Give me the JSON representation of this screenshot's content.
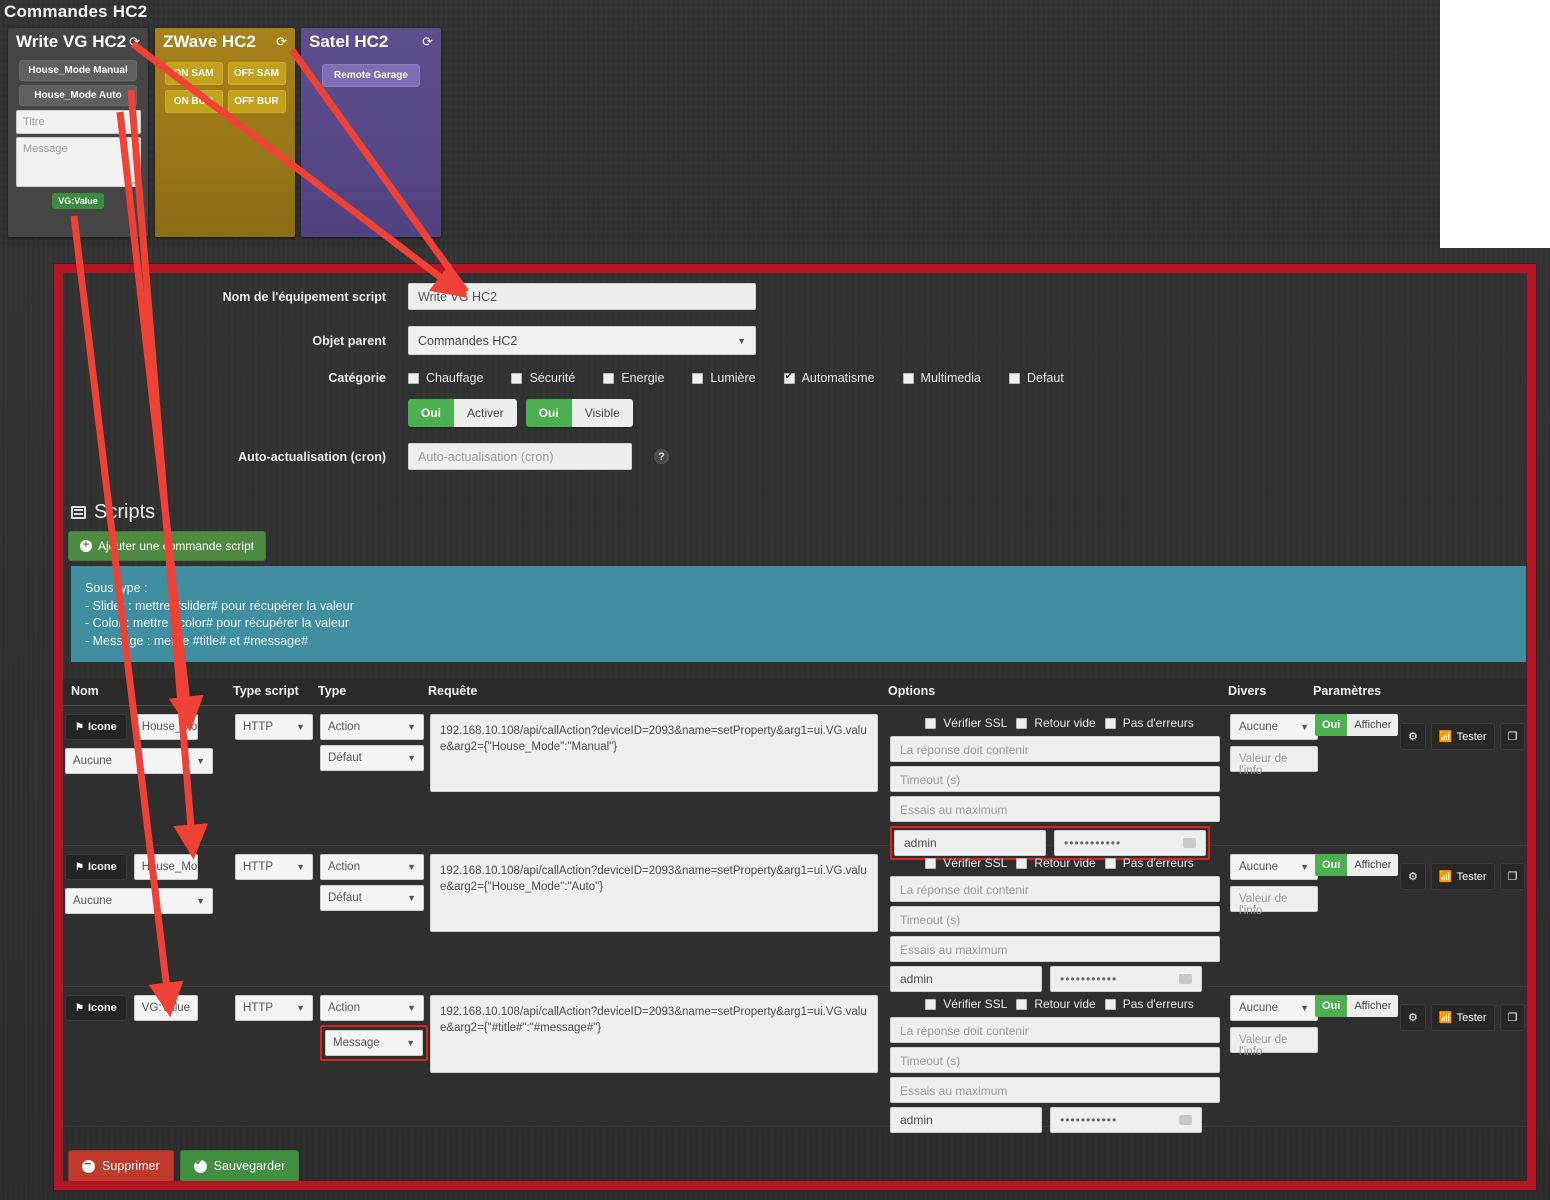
{
  "dashboard": {
    "title": "Commandes HC2",
    "refresh_icon": "refresh-icon",
    "widgets": [
      {
        "title": "Write VG HC2",
        "color": "#454545",
        "buttons": [
          "House_Mode Manual",
          "House_Mode Auto"
        ],
        "inputs": [
          {
            "placeholder": "Titre"
          },
          {
            "placeholder": "Message"
          }
        ],
        "badge": "VG:Value",
        "badge_color": "#3c8c40"
      },
      {
        "title": "ZWave HC2",
        "color": "#9a7718",
        "buttons": [
          "ON SAM",
          "OFF SAM",
          "ON BUR",
          "OFF BUR"
        ]
      },
      {
        "title": "Satel HC2",
        "color": "#564787",
        "buttons": [
          "Remote Garage"
        ]
      }
    ]
  },
  "form": {
    "name": {
      "label": "Nom de l'équipement script",
      "value": "Write VG HC2",
      "placeholder": "Nom de l'équipement script"
    },
    "parent": {
      "label": "Objet parent",
      "value": "Commandes HC2"
    },
    "category": {
      "label": "Catégorie",
      "items": [
        {
          "label": "Chauffage",
          "checked": false
        },
        {
          "label": "Sécurité",
          "checked": false
        },
        {
          "label": "Energie",
          "checked": false
        },
        {
          "label": "Lumière",
          "checked": false
        },
        {
          "label": "Automatisme",
          "checked": true
        },
        {
          "label": "Multimedia",
          "checked": false
        },
        {
          "label": "Defaut",
          "checked": false
        }
      ]
    },
    "toggles": [
      {
        "on_label": "Oui",
        "off_label": "Activer"
      },
      {
        "on_label": "Oui",
        "off_label": "Visible"
      }
    ],
    "cron": {
      "label": "Auto-actualisation (cron)",
      "placeholder": "Auto-actualisation (cron)",
      "value": "",
      "help_icon": "help-icon"
    }
  },
  "scripts": {
    "heading": "Scripts",
    "heading_icon": "list-icon",
    "add_button": "Ajouter une commande script",
    "info": [
      "Sous type :",
      "- Slider : mettre #slider# pour récupérer la valeur",
      "- Color : mettre #color# pour récupérer la valeur",
      "- Message : mettre #title# et #message#"
    ],
    "info_bg": "#3f8fa0",
    "columns": [
      "Nom",
      "Type script",
      "Type",
      "Requête",
      "Options",
      "Divers",
      "Paramètres"
    ],
    "option_checks": [
      "Vérifier SSL",
      "Retour vide",
      "Pas d'erreurs"
    ],
    "option_placeholders": [
      "La réponse doit contenir",
      "Timeout (s)",
      "Essais au maximum"
    ],
    "divers_placeholder": "Valeur de l'info",
    "icone_label": "Icone",
    "icone_icon": "flag-icon",
    "action_icons": {
      "config": "gears-icon",
      "test_label": "Tester",
      "test_icon": "rss-icon",
      "duplicate": "copy-icon",
      "remove": "minus-circle-icon"
    },
    "rows": [
      {
        "name_value": "House_Mo",
        "icon_select": "Aucune",
        "type_script": "HTTP",
        "type": "Action",
        "subtype": "Défaut",
        "subtype_highlighted": false,
        "request": "192.168.10.108/api/callAction?deviceID=2093&name=setProperty&arg1=ui.VG.value&arg2={\"House_Mode\":\"Manual\"}",
        "user": "admin",
        "password": "•••••••••••",
        "credentials_highlighted": true,
        "divers": "Aucune",
        "param_on": "Oui",
        "param_off": "Afficher"
      },
      {
        "name_value": "House_Mo",
        "icon_select": "Aucune",
        "type_script": "HTTP",
        "type": "Action",
        "subtype": "Défaut",
        "subtype_highlighted": false,
        "request": "192.168.10.108/api/callAction?deviceID=2093&name=setProperty&arg1=ui.VG.value&arg2={\"House_Mode\":\"Auto\"}",
        "user": "admin",
        "password": "•••••••••••",
        "credentials_highlighted": false,
        "divers": "Aucune",
        "param_on": "Oui",
        "param_off": "Afficher"
      },
      {
        "name_value": "VG:Value",
        "icon_select": "",
        "type_script": "HTTP",
        "type": "Action",
        "subtype": "Message",
        "subtype_highlighted": true,
        "request": "192.168.10.108/api/callAction?deviceID=2093&name=setProperty&arg1=ui.VG.value&arg2={\"#title#\":\"#message#\"}",
        "user": "admin",
        "password": "•••••••••••",
        "credentials_highlighted": false,
        "divers": "Aucune",
        "param_on": "Oui",
        "param_off": "Afficher"
      }
    ]
  },
  "footer": {
    "delete_label": "Supprimer",
    "save_label": "Sauvegarder",
    "delete_color": "#c0392b",
    "save_color": "#3f8f3f"
  },
  "annotation": {
    "color": "#ef4136",
    "frame_color": "#b51522"
  }
}
